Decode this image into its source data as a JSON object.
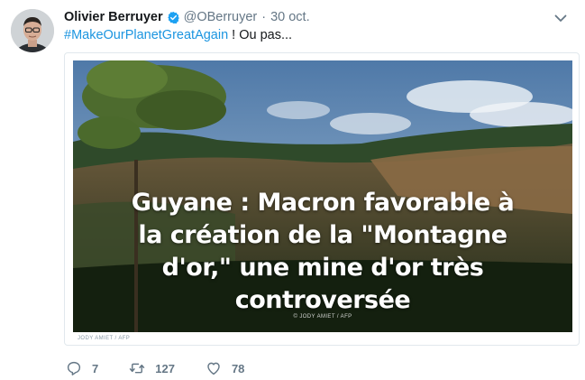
{
  "tweet": {
    "author_name": "Olivier Berruyer",
    "handle": "@OBerruyer",
    "separator": "·",
    "date": "30 oct.",
    "hashtag": "#MakeOurPlanetGreatAgain",
    "text_rest": " ! Ou pas...",
    "verified": true
  },
  "media": {
    "headline_lines": [
      "Guyane : Macron favorable à",
      "la création de la \"Montagne",
      "d'or,\" une mine d'or très",
      "controversée"
    ],
    "credit_overlay": "© JODY AMIET / AFP",
    "credit_below": "JODY AMIET / AFP"
  },
  "actions": {
    "reply": {
      "icon": "reply-icon",
      "count": "7"
    },
    "retweet": {
      "icon": "retweet-icon",
      "count": "127"
    },
    "like": {
      "icon": "heart-icon",
      "count": "78"
    }
  },
  "colors": {
    "link": "#1b95e0",
    "verified_badge": "#1da1f2",
    "muted": "#657786"
  }
}
